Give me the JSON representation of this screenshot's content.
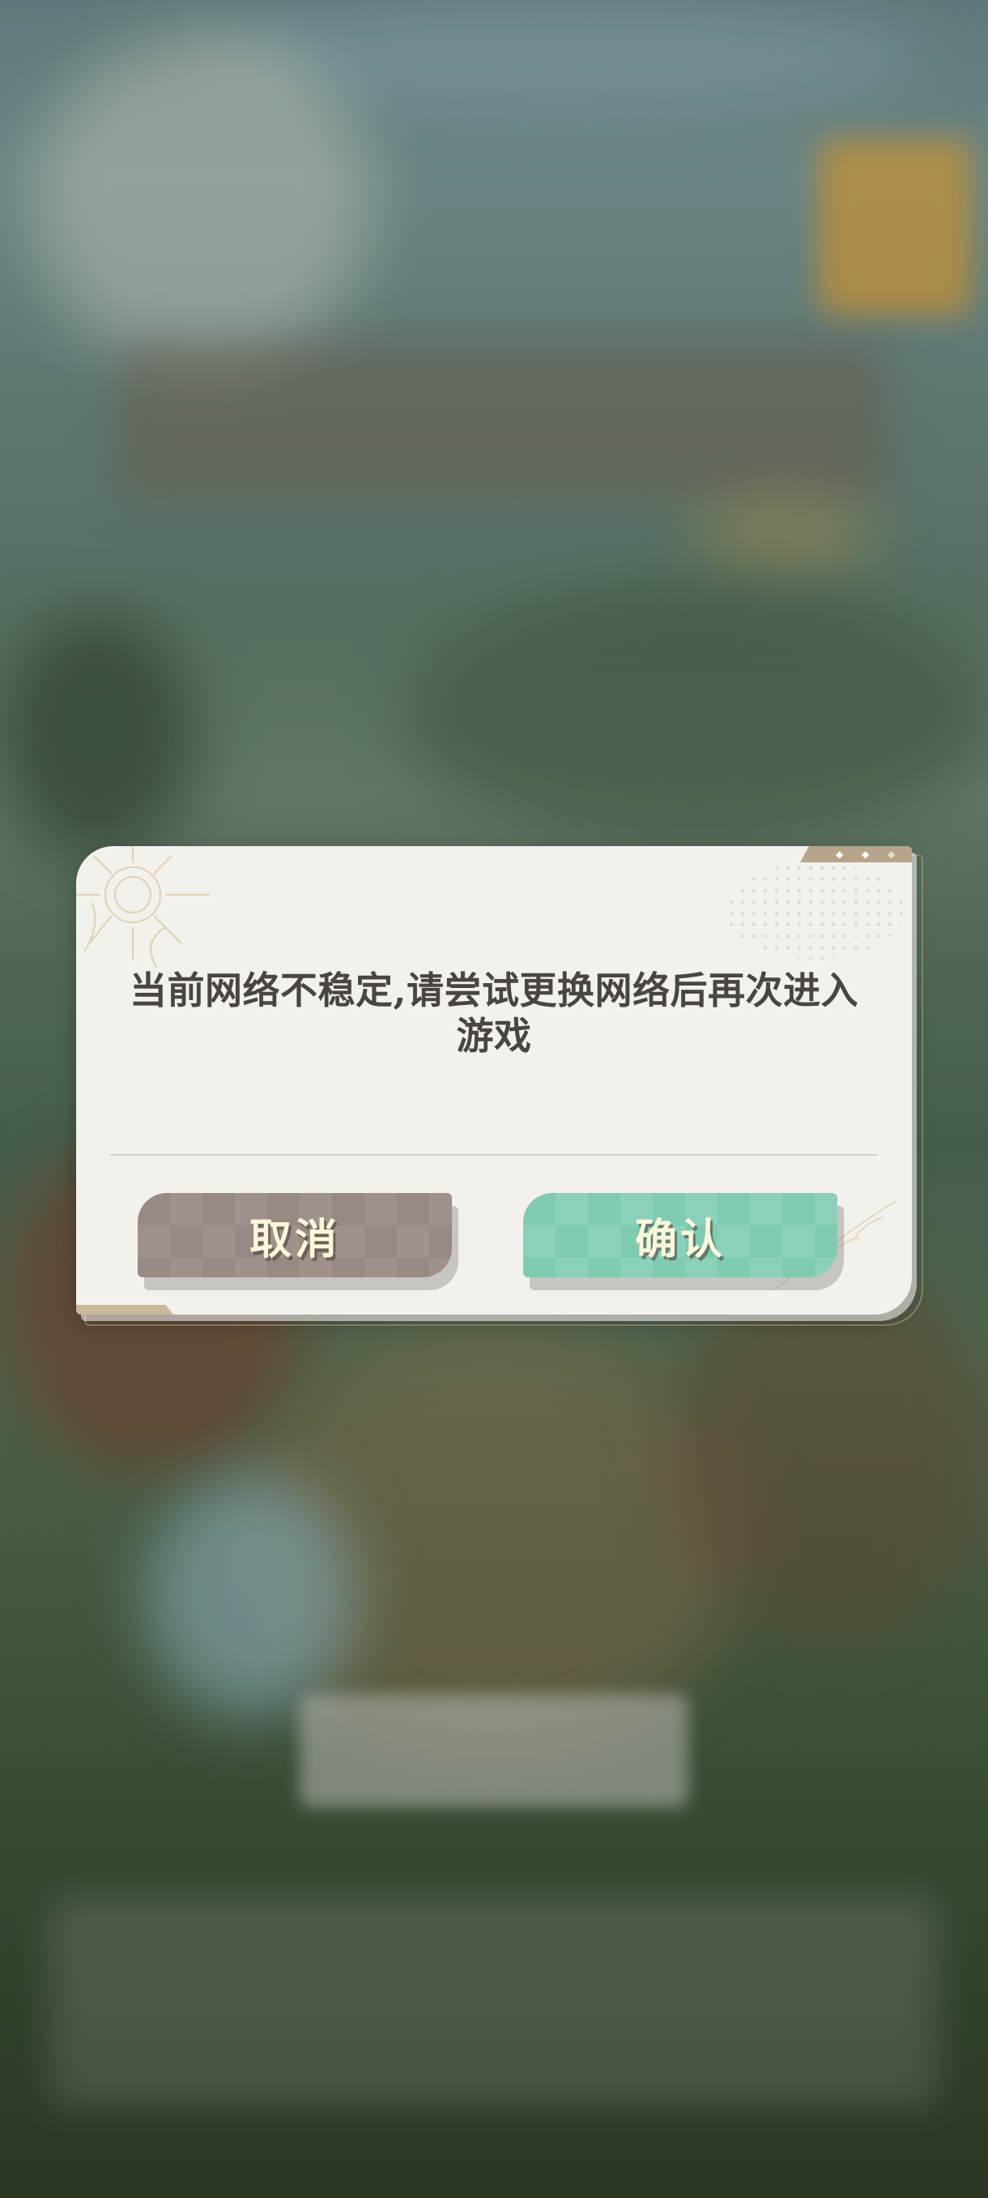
{
  "dialog": {
    "message": "当前网络不稳定,请尝试更换网络后再次进入游戏",
    "cancel_label": "取消",
    "confirm_label": "确认"
  },
  "colors": {
    "dialog_background": "#f2f1ec",
    "message_text": "#4a4543",
    "cancel_button": "#978a82",
    "confirm_button": "#7ecbb2",
    "button_text": "#fbf6dc"
  },
  "icons": {
    "corner_deco": "sun-ornament-icon",
    "tab_marks": "diamond-marks-icon"
  }
}
